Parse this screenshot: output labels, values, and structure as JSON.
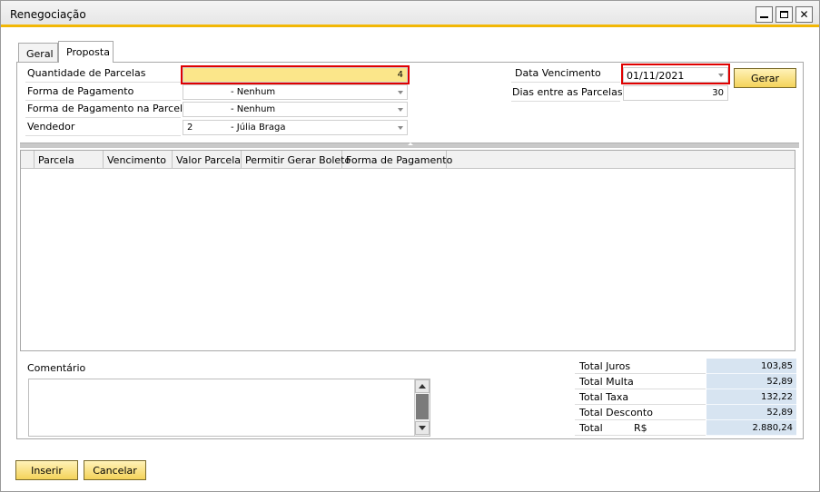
{
  "window": {
    "title": "Renegociação"
  },
  "tabs": [
    {
      "label": "Geral"
    },
    {
      "label": "Proposta"
    }
  ],
  "form": {
    "quantidade_label": "Quantidade de Parcelas",
    "quantidade_value": "4",
    "forma_pagamento_label": "Forma de Pagamento",
    "forma_pagamento_value": "- Nenhum",
    "forma_parcela_label": "Forma de Pagamento na Parcela",
    "forma_parcela_value": "- Nenhum",
    "vendedor_label": "Vendedor",
    "vendedor_code": "2",
    "vendedor_name": "- Júlia Braga",
    "data_vencimento_label": "Data Vencimento",
    "data_vencimento_value": "01/11/2021",
    "dias_label": "Dias entre as Parcelas",
    "dias_value": "30",
    "gerar_label": "Gerar"
  },
  "grid": {
    "columns": [
      "Parcela",
      "Vencimento",
      "Valor Parcela",
      "Permitir Gerar Boleto",
      "Forma de Pagamento"
    ]
  },
  "comment": {
    "label": "Comentário"
  },
  "totals": [
    {
      "label": "Total  Juros",
      "currency": "",
      "value": "103,85"
    },
    {
      "label": "Total Multa",
      "currency": "",
      "value": "52,89"
    },
    {
      "label": "Total Taxa",
      "currency": "",
      "value": "132,22"
    },
    {
      "label": "Total Desconto",
      "currency": "",
      "value": "52,89"
    },
    {
      "label": "Total",
      "currency": "R$",
      "value": "2.880,24"
    }
  ],
  "footer": {
    "inserir_label": "Inserir",
    "cancelar_label": "Cancelar"
  },
  "colors": {
    "accent": "#f2b705",
    "highlight_field": "#fbe68a",
    "red_box": "#e00000",
    "totals_bg": "#d7e4f1"
  }
}
